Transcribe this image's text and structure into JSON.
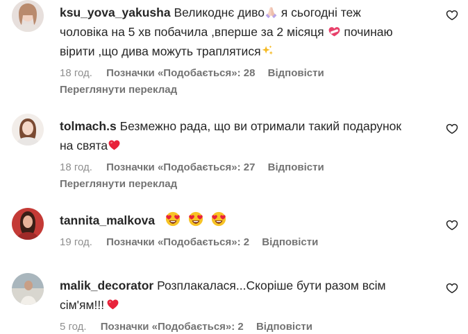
{
  "comments": [
    {
      "username": "ksu_yova_yakusha",
      "line1": "Великоднє диво",
      "line1b": " я сьогодні теж",
      "line2": "чоловіка на 5 хв побачила ,вперше за 2 місяця",
      "line2b": " починаю",
      "line3": "вірити ,що дива можуть траплятися",
      "time": "18 год.",
      "likes": "Позначки «Подобається»: 28",
      "reply": "Відповісти",
      "translate": "Переглянути переклад",
      "emoji": [
        "praying-hands",
        "mending-heart",
        "sparkles"
      ]
    },
    {
      "username": "tolmach.s",
      "line1": "Безмежно рада, що ви отримали такий подарунок",
      "line2": "на свята",
      "time": "18 год.",
      "likes": "Позначки «Подобається»: 27",
      "reply": "Відповісти",
      "translate": "Переглянути переклад",
      "emoji": [
        "red-heart"
      ]
    },
    {
      "username": "tannita_malkova",
      "time": "19 год.",
      "likes": "Позначки «Подобається»: 2",
      "reply": "Відповісти",
      "emoji": [
        "heart-eyes",
        "heart-eyes",
        "heart-eyes"
      ]
    },
    {
      "username": "malik_decorator",
      "line1": "Розплакалася...Скоріше бути разом всім",
      "line2": "сім'ям!!!",
      "time": "5 год.",
      "likes": "Позначки «Подобається»: 2",
      "reply": "Відповісти",
      "emoji": [
        "red-heart"
      ]
    }
  ],
  "colors": {
    "text": "#262626",
    "secondary": "#737373",
    "heart_emoji": "#e8223a",
    "heart_eyes_face": "#f7c325"
  }
}
